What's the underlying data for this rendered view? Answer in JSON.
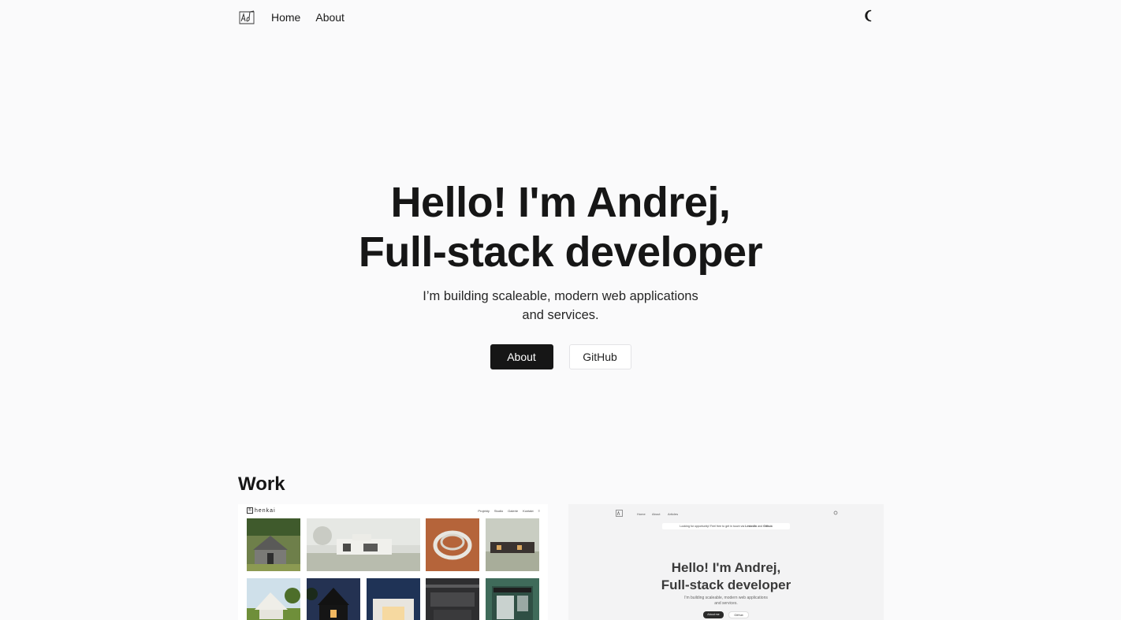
{
  "nav": {
    "logo_icon": "signature-logo-icon",
    "links": [
      {
        "label": "Home"
      },
      {
        "label": "About"
      }
    ],
    "theme_toggle_icon": "moon-icon"
  },
  "hero": {
    "title_line1": "Hello! I'm Andrej,",
    "title_line2": "Full-stack developer",
    "subtitle_line1": "I’m building scaleable, modern web applications",
    "subtitle_line2": "and services.",
    "buttons": {
      "primary_label": "About",
      "secondary_label": "GitHub"
    }
  },
  "work": {
    "title": "Work",
    "projects": [
      {
        "preview_brand": "henkai",
        "preview_nav": [
          "Projekty",
          "Studio",
          "Galerie",
          "Kontakt"
        ]
      },
      {
        "preview_nav": [
          "Home",
          "About",
          "Articles"
        ],
        "preview_banner_prefix": "Looking for opportunity! Feel free to get in touch via",
        "preview_banner_link1": "LinkedIn",
        "preview_banner_and": "and",
        "preview_banner_link2": "Github",
        "preview_title_line1": "Hello! I'm Andrej,",
        "preview_title_line2": "Full-stack developer",
        "preview_sub_line1": "I'm building scaleable, modern web applications",
        "preview_sub_line2": "and services.",
        "preview_btn_primary": "About me",
        "preview_btn_secondary": "GitHub"
      }
    ]
  },
  "colors": {
    "background": "#fafafb",
    "text": "#161616",
    "primary_button": "#161616"
  }
}
